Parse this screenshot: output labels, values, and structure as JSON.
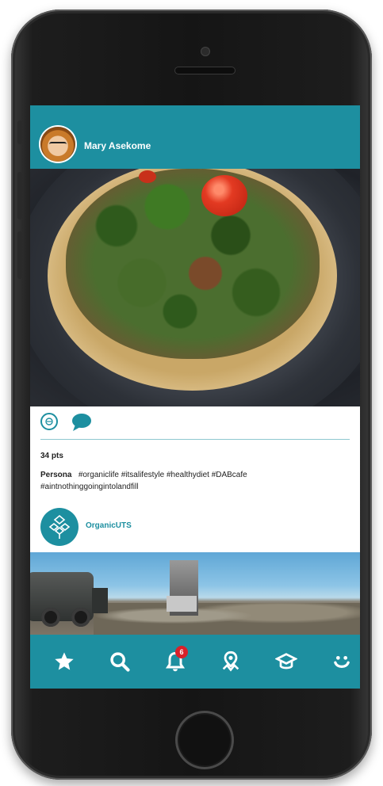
{
  "post": {
    "username": "Mary Asekome",
    "points": "34 pts",
    "caption_user": "Persona",
    "caption_text": "#organiclife #itsalifestyle #healthydiet #DABcafe #aintnothinggoingintolandfill"
  },
  "suggested": {
    "name": "OrganicUTS"
  },
  "navbar": {
    "items": [
      {
        "icon": "star-icon"
      },
      {
        "icon": "search-icon"
      },
      {
        "icon": "bell-icon",
        "badge": "6"
      },
      {
        "icon": "map-pin-icon"
      },
      {
        "icon": "graduation-cap-icon"
      },
      {
        "icon": "smiley-icon"
      }
    ]
  },
  "colors": {
    "accent": "#1d8fa0",
    "badge": "#d9202a"
  }
}
